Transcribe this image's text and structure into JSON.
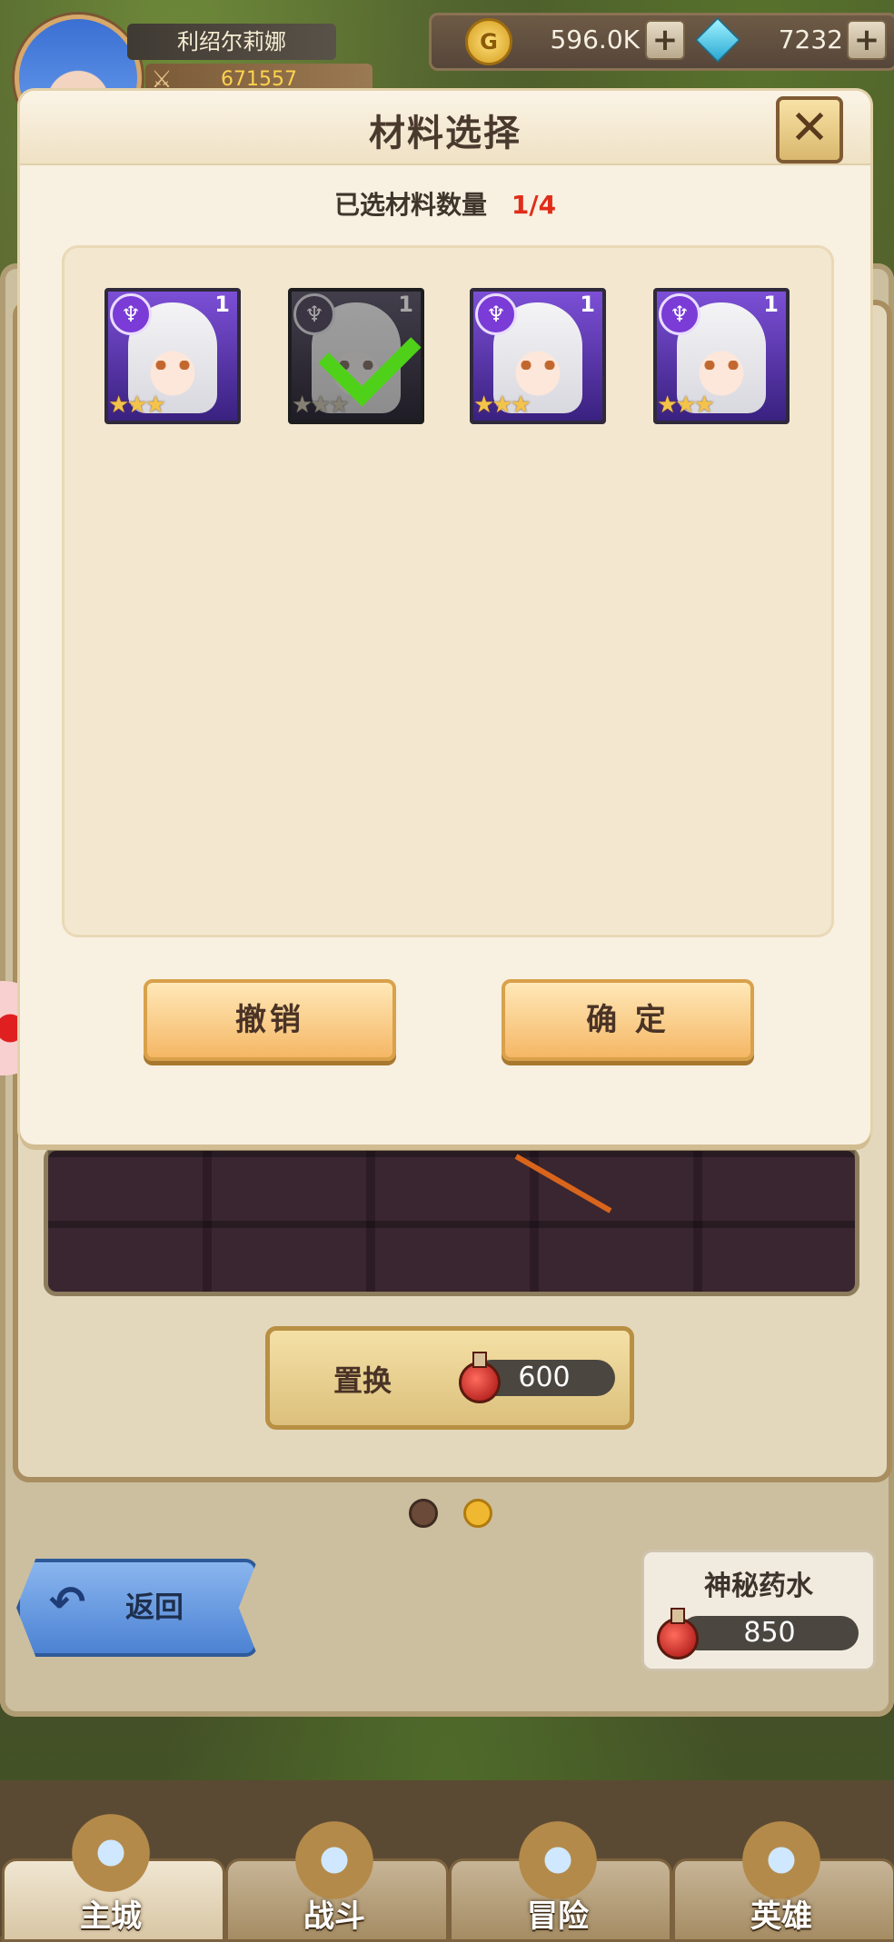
{
  "player": {
    "name": "利绍尔莉娜",
    "power": "671557"
  },
  "currency": {
    "coins": "596.0K",
    "gems": "7232",
    "plus": "+"
  },
  "modal": {
    "title": "材料选择",
    "close_label": "✕",
    "selected_label": "已选材料数量",
    "selected_value": "1/4",
    "materials": [
      {
        "level": "1",
        "stars": "★★★",
        "selected": false
      },
      {
        "level": "1",
        "stars": "★★★",
        "selected": true
      },
      {
        "level": "1",
        "stars": "★★★",
        "selected": false
      },
      {
        "level": "1",
        "stars": "★★★",
        "selected": false
      }
    ],
    "cancel_label": "撤销",
    "confirm_label": "确 定"
  },
  "swap": {
    "label": "置换",
    "cost": "600"
  },
  "back_label": "返回",
  "potion": {
    "title": "神秘药水",
    "count": "850"
  },
  "nav": [
    {
      "label": "主城",
      "active": true
    },
    {
      "label": "战斗",
      "active": false
    },
    {
      "label": "冒险",
      "active": false
    },
    {
      "label": "英雄",
      "active": false
    }
  ],
  "colors": {
    "accent_red": "#e02d1a",
    "check_green": "#4fd11a",
    "star_gold": "#f4c34a"
  }
}
